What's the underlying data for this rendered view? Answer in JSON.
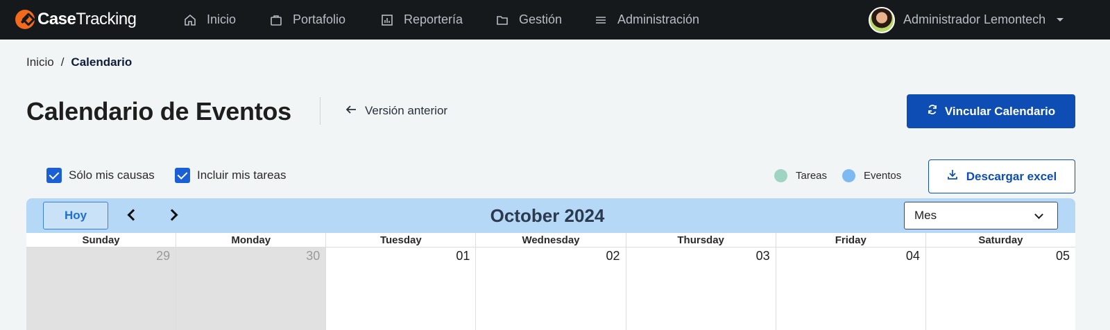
{
  "nav": {
    "brand_bold": "Case",
    "brand_rest": "Tracking",
    "items": [
      {
        "label": "Inicio",
        "icon": "home-icon"
      },
      {
        "label": "Portafolio",
        "icon": "briefcase-icon"
      },
      {
        "label": "Reportería",
        "icon": "bar-chart-icon"
      },
      {
        "label": "Gestión",
        "icon": "folder-icon"
      },
      {
        "label": "Administración",
        "icon": "menu-icon"
      }
    ],
    "user_name": "Administrador Lemontech"
  },
  "breadcrumb": {
    "root": "Inicio",
    "separator": "/",
    "current": "Calendario"
  },
  "header": {
    "title": "Calendario de Eventos",
    "back_label": "Versión anterior",
    "link_button": "Vincular Calendario"
  },
  "filters": {
    "only_my_cases": "Sólo mis causas",
    "include_my_tasks": "Incluir mis tareas"
  },
  "legend": [
    {
      "label": "Tareas",
      "color": "#9fd4c3"
    },
    {
      "label": "Eventos",
      "color": "#7fb9f2"
    }
  ],
  "export_button": "Descargar excel",
  "calendar": {
    "today_label": "Hoy",
    "title": "October 2024",
    "view": "Mes",
    "weekdays": [
      "Sunday",
      "Monday",
      "Tuesday",
      "Wednesday",
      "Thursday",
      "Friday",
      "Saturday"
    ],
    "first_week": [
      {
        "day": "29",
        "outside_month": true
      },
      {
        "day": "30",
        "outside_month": true
      },
      {
        "day": "01",
        "outside_month": false
      },
      {
        "day": "02",
        "outside_month": false
      },
      {
        "day": "03",
        "outside_month": false
      },
      {
        "day": "04",
        "outside_month": false
      },
      {
        "day": "05",
        "outside_month": false
      }
    ]
  },
  "colors": {
    "primary": "#0e4db3",
    "navbar": "#16191c",
    "calendar_header": "#b5d8f6",
    "brand_accent": "#f26a1b"
  }
}
